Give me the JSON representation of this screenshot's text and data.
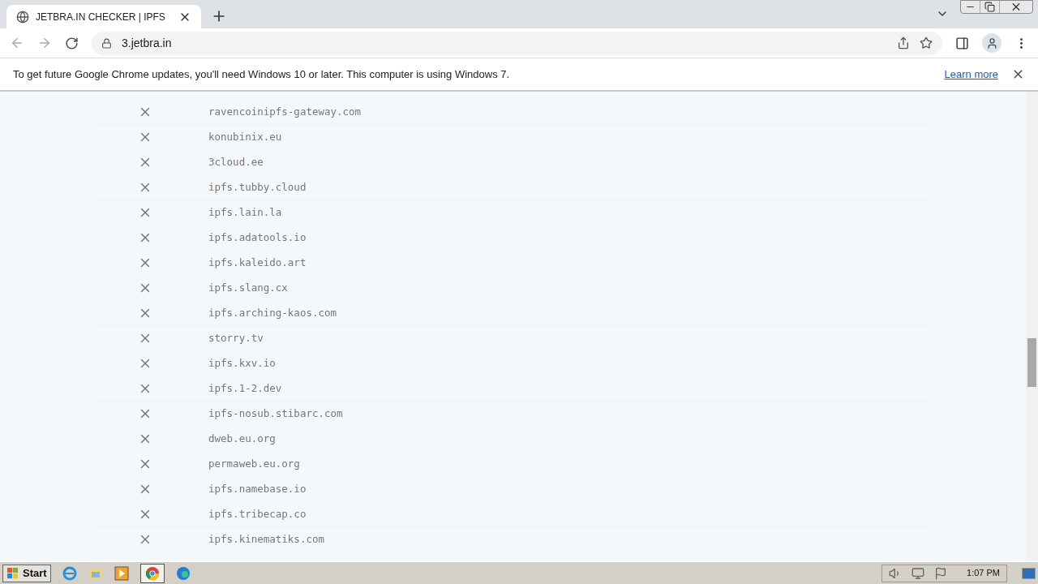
{
  "tab": {
    "title": "JETBRA.IN CHECKER | IPFS",
    "selected": true
  },
  "address_bar": {
    "url": "3.jetbra.in"
  },
  "banner": {
    "message": "To get future Google Chrome updates, you'll need Windows 10 or later. This computer is using Windows 7.",
    "link": "Learn more"
  },
  "gateways": [
    {
      "kind": "failed",
      "host": "ravencoinipfs-gateway.com"
    },
    {
      "kind": "failed",
      "host": "konubinix.eu"
    },
    {
      "kind": "failed",
      "host": "3cloud.ee"
    },
    {
      "kind": "failed",
      "host": "ipfs.tubby.cloud"
    },
    {
      "kind": "failed",
      "host": "ipfs.lain.la"
    },
    {
      "kind": "failed",
      "host": "ipfs.adatools.io"
    },
    {
      "kind": "failed",
      "host": "ipfs.kaleido.art"
    },
    {
      "kind": "failed",
      "host": "ipfs.slang.cx"
    },
    {
      "kind": "failed",
      "host": "ipfs.arching-kaos.com"
    },
    {
      "kind": "failed",
      "host": "storry.tv"
    },
    {
      "kind": "failed",
      "host": "ipfs.kxv.io"
    },
    {
      "kind": "failed",
      "host": "ipfs.1-2.dev"
    },
    {
      "kind": "failed",
      "host": "ipfs-nosub.stibarc.com"
    },
    {
      "kind": "failed",
      "host": "dweb.eu.org"
    },
    {
      "kind": "failed",
      "host": "permaweb.eu.org"
    },
    {
      "kind": "failed",
      "host": "ipfs.namebase.io"
    },
    {
      "kind": "failed",
      "host": "ipfs.tribecap.co"
    },
    {
      "kind": "failed",
      "host": "ipfs.kinematiks.com"
    }
  ],
  "taskbar": {
    "start": "Start",
    "clock": "1:07 PM"
  }
}
